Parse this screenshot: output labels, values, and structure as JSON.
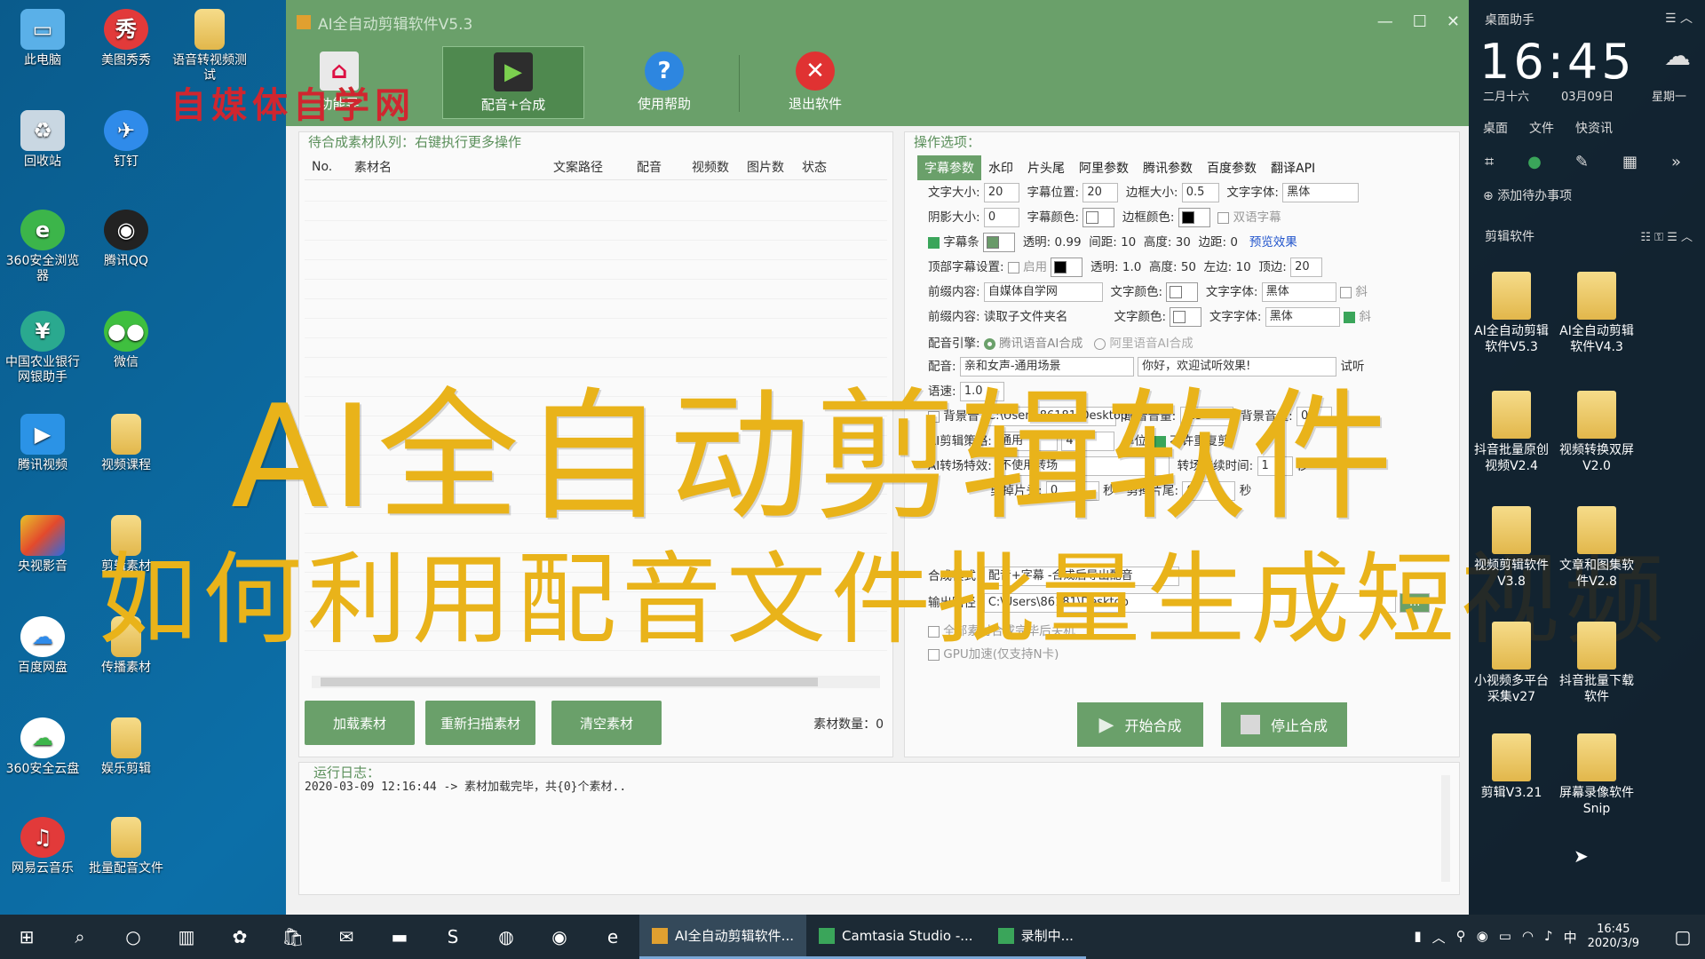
{
  "desktop": {
    "icons": [
      {
        "label": "此电脑"
      },
      {
        "label": "美图秀秀"
      },
      {
        "label": "语音转视频测试"
      },
      {
        "label": "回收站"
      },
      {
        "label": "钉钉"
      },
      {
        "label": "360安全浏览器"
      },
      {
        "label": "腾讯QQ"
      },
      {
        "label": "中国农业银行网银助手"
      },
      {
        "label": "微信"
      },
      {
        "label": "腾讯视频"
      },
      {
        "label": "视频课程"
      },
      {
        "label": "央视影音"
      },
      {
        "label": "剪辑素材"
      },
      {
        "label": "百度网盘"
      },
      {
        "label": "传播素材"
      },
      {
        "label": "360安全云盘"
      },
      {
        "label": "娱乐剪辑"
      },
      {
        "label": "网易云音乐"
      },
      {
        "label": "批量配音文件"
      }
    ]
  },
  "watermark": "自媒体自学网",
  "window": {
    "title": "AI全自动剪辑软件V5.3",
    "toolbar": [
      {
        "label": "功能导"
      },
      {
        "label": "配音+合成"
      },
      {
        "label": "使用帮助"
      },
      {
        "label": "退出软件"
      }
    ],
    "queue": {
      "title": "待合成素材队列：右键执行更多操作",
      "columns": [
        "No.",
        "素材名",
        "文案路径",
        "配音",
        "视频数",
        "图片数",
        "状态"
      ],
      "buttons": {
        "load": "加载素材",
        "rescan": "重新扫描素材",
        "clear": "清空素材"
      },
      "count_label": "素材数量：0"
    },
    "options": {
      "title": "操作选项：",
      "tabs": [
        "字幕参数",
        "水印",
        "片头尾",
        "阿里参数",
        "腾讯参数",
        "百度参数",
        "翻译API"
      ],
      "r1": {
        "font_size_l": "文字大小:",
        "font_size": "20",
        "pos_l": "字幕位置:",
        "pos": "20",
        "border_l": "边框大小:",
        "border": "0.5",
        "font_l": "文字字体:",
        "font": "黑体"
      },
      "r2": {
        "shadow_l": "阴影大小:",
        "shadow": "0",
        "color_l": "字幕颜色:",
        "bcolor_l": "边框颜色:",
        "dual": "双语字幕"
      },
      "r3": {
        "bar": "字幕条",
        "alpha_l": "透明:",
        "alpha": "0.99",
        "gap_l": "间距:",
        "gap": "10",
        "h_l": "高度:",
        "h": "30",
        "m_l": "边距:",
        "m": "0",
        "preview": "预览效果"
      },
      "r4": {
        "top_l": "顶部字幕设置:",
        "enable": "启用",
        "alpha_l": "透明:",
        "alpha": "1.0",
        "h_l": "高度:",
        "h": "50",
        "left_l": "左边:",
        "left": "10",
        "right_l": "顶边:",
        "right": "20"
      },
      "r5": {
        "prefix_l": "前缀内容:",
        "prefix": "自媒体自学网",
        "color_l": "文字颜色:",
        "font_l": "文字字体:",
        "font": "黑体",
        "italic": "斜"
      },
      "r6": {
        "prefix_l": "前缀内容:",
        "prefix": "读取子文件夹名",
        "color_l": "文字颜色:",
        "font_l": "文字字体:",
        "font": "黑体",
        "italic": "斜"
      },
      "engine_l": "配音引擎:",
      "engine_a": "腾讯语音AI合成",
      "engine_b": "阿里语音AI合成",
      "voice_l": "配音:",
      "voice": "亲和女声-通用场景",
      "test": "你好，欢迎试听效果!",
      "listen": "试听",
      "speed_l": "语速:",
      "speed": "1.0",
      "bgm_l": "背景音",
      "bgm_path": "C:\\Users\\86181\\Desktop",
      "vol_l": "配音音量:",
      "vol": "1.5",
      "bgvol_l": "背景音量:",
      "bgvol": "0",
      "cut_l": "AI剪辑策略:",
      "cut": "通用",
      "cut_n": "4",
      "unit_l": "单位:",
      "norepeat": "不许重复剪",
      "trans_l": "AI转场特效:",
      "trans": "不使用转场",
      "trans_time_l": "转场持续时间:",
      "trans_time": "1",
      "sec": "秒",
      "head_l": "剪掉片头:",
      "head": "0",
      "tail_l": "剪掉片尾:",
      "tail": "0",
      "mode_l": "合成模式:",
      "mode": "配音+字幕 -合成后导出配音",
      "out_l": "输出路径:",
      "out": "C:\\Users\\86181\\Desktop",
      "browse": "...",
      "shutdown": "全部素材合成完毕后关机",
      "gpu": "GPU加速(仅支持N卡)",
      "start": "开始合成",
      "stop": "停止合成"
    },
    "log": {
      "title": "运行日志：",
      "line": "2020-03-09 12:16:44 -> 素材加载完毕，共{0}个素材.."
    }
  },
  "captions": {
    "line1": "AI全自动剪辑软件",
    "line2": "如何利用配音文件批量生成短视频"
  },
  "sidebar": {
    "title": "桌面助手",
    "time": "16:45",
    "lunar": "二月十六",
    "date": "03月09日",
    "weekday": "星期一",
    "nav": [
      "桌面",
      "文件",
      "快资讯"
    ],
    "todo": "添加待办事项",
    "group": "剪辑软件",
    "apps": [
      {
        "label": "AI全自动剪辑软件V5.3"
      },
      {
        "label": "AI全自动剪辑软件V4.3"
      },
      {
        "label": "抖音批量原创视频V2.4"
      },
      {
        "label": "视频转换双屏V2.0"
      },
      {
        "label": "视频剪辑软件V3.8"
      },
      {
        "label": "文章和图集软件V2.8"
      },
      {
        "label": "小视频多平台采集v27"
      },
      {
        "label": "抖音批量下载软件"
      },
      {
        "label": "剪辑V3.21"
      },
      {
        "label": "屏幕录像软件Snip"
      }
    ]
  },
  "taskbar": {
    "apps": [
      {
        "label": "AI全自动剪辑软件..."
      },
      {
        "label": "Camtasia Studio -..."
      },
      {
        "label": "录制中..."
      }
    ],
    "clock_time": "16:45",
    "clock_date": "2020/3/9"
  }
}
